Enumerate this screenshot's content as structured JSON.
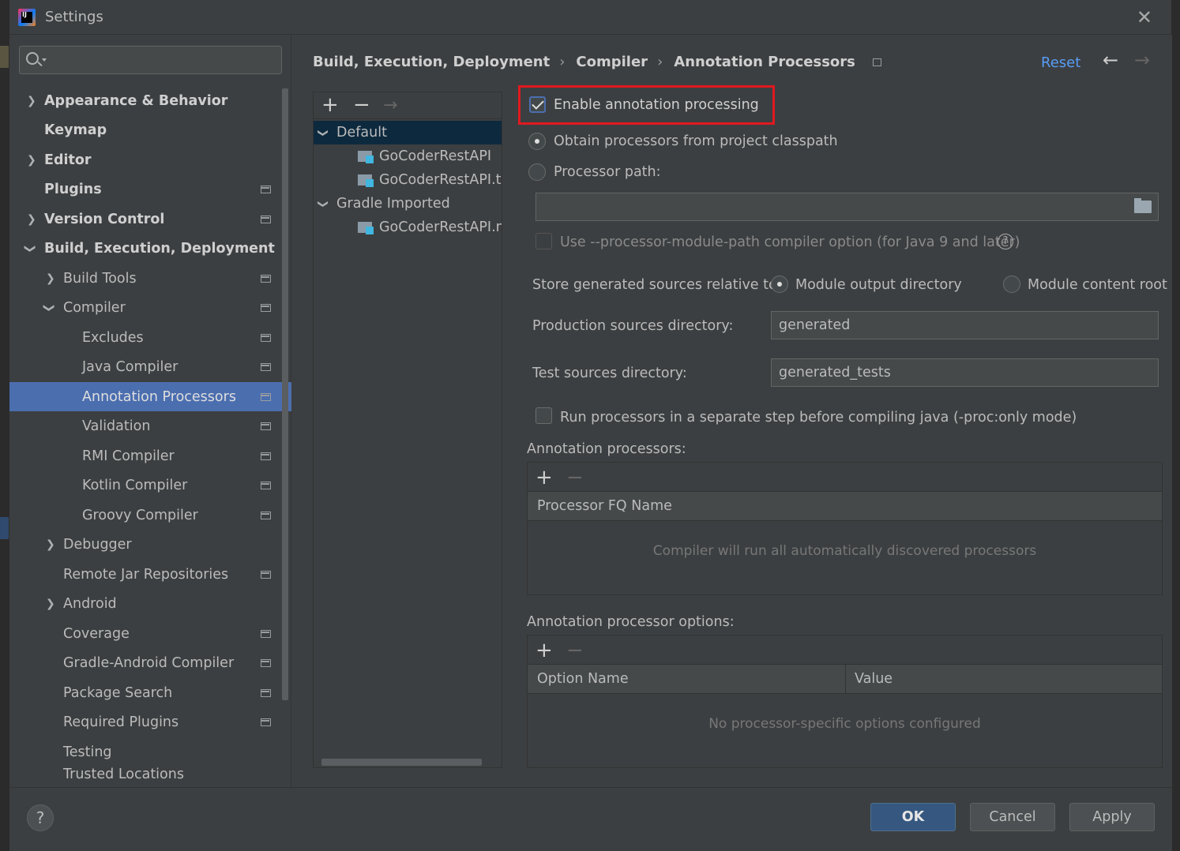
{
  "window": {
    "title": "Settings"
  },
  "search": {
    "placeholder": ""
  },
  "sidebar": {
    "items": [
      {
        "label": "Appearance & Behavior"
      },
      {
        "label": "Keymap"
      },
      {
        "label": "Editor"
      },
      {
        "label": "Plugins"
      },
      {
        "label": "Version Control"
      },
      {
        "label": "Build, Execution, Deployment"
      },
      {
        "label": "Build Tools"
      },
      {
        "label": "Compiler"
      },
      {
        "label": "Excludes"
      },
      {
        "label": "Java Compiler"
      },
      {
        "label": "Annotation Processors"
      },
      {
        "label": "Validation"
      },
      {
        "label": "RMI Compiler"
      },
      {
        "label": "Kotlin Compiler"
      },
      {
        "label": "Groovy Compiler"
      },
      {
        "label": "Debugger"
      },
      {
        "label": "Remote Jar Repositories"
      },
      {
        "label": "Android"
      },
      {
        "label": "Coverage"
      },
      {
        "label": "Gradle-Android Compiler"
      },
      {
        "label": "Package Search"
      },
      {
        "label": "Required Plugins"
      },
      {
        "label": "Testing"
      },
      {
        "label": "Trusted Locations"
      }
    ]
  },
  "breadcrumb": {
    "items": [
      "Build, Execution, Deployment",
      "Compiler",
      "Annotation Processors"
    ],
    "reset": "Reset"
  },
  "profiles": {
    "nodes": [
      "Default",
      "GoCoderRestAPI",
      "GoCoderRestAPI.te",
      "Gradle Imported",
      "GoCoderRestAPI.m"
    ]
  },
  "settings": {
    "enable_label": "Enable annotation processing",
    "obtain_label": "Obtain processors from project classpath",
    "processor_path_label": "Processor path:",
    "module_path_label": "Use --processor-module-path compiler option (for Java 9 and later)",
    "store_label": "Store generated sources relative to:",
    "module_output": "Module output directory",
    "module_content": "Module content root",
    "production_label": "Production sources directory:",
    "production_value": "generated",
    "test_label": "Test sources directory:",
    "test_value": "generated_tests",
    "run_separate_label": "Run processors in a separate step before compiling java (-proc:only mode)",
    "processors_title": "Annotation processors:",
    "processors_col": "Processor FQ Name",
    "processors_empty": "Compiler will run all automatically discovered processors",
    "options_title": "Annotation processor options:",
    "options_col1": "Option Name",
    "options_col2": "Value",
    "options_empty": "No processor-specific options configured"
  },
  "footer": {
    "ok": "OK",
    "cancel": "Cancel",
    "apply": "Apply",
    "help": "?"
  }
}
